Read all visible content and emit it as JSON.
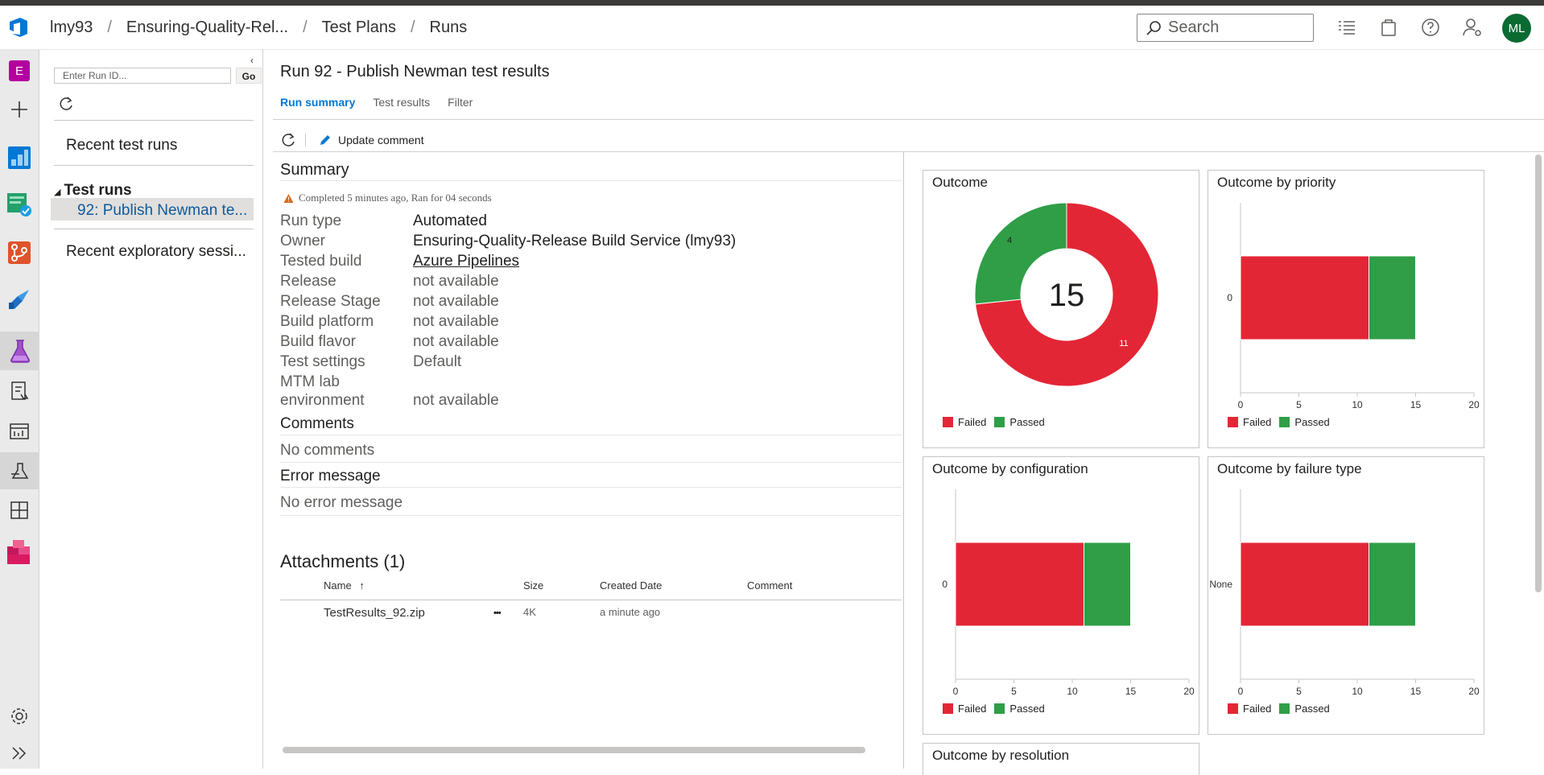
{
  "header": {
    "breadcrumbs": [
      "lmy93",
      "Ensuring-Quality-Rel...",
      "Test Plans",
      "Runs"
    ],
    "search_placeholder": "Search",
    "avatar_initials": "ML"
  },
  "leftnav": {
    "project_letter": "E",
    "icons": [
      "project-icon",
      "add-icon",
      "boards-icon",
      "test-plans-check-icon",
      "repos-icon",
      "pipelines-icon",
      "test-plans-icon",
      "test-plan-doc-icon",
      "dashboard-icon",
      "runs-icon",
      "grid-icon",
      "artifacts-icon",
      "settings-icon",
      "expand-icon"
    ]
  },
  "runpanel": {
    "run_id_placeholder": "Enter Run ID...",
    "go_label": "Go",
    "recent_runs": "Recent test runs",
    "test_runs_header": "Test runs",
    "selected_run": "92: Publish Newman te...",
    "recent_exploratory": "Recent exploratory sessi..."
  },
  "main": {
    "title": "Run 92 - Publish Newman test results",
    "tabs": [
      "Run summary",
      "Test results",
      "Filter"
    ],
    "toolbar": {
      "update_comment": "Update comment"
    }
  },
  "summary": {
    "heading": "Summary",
    "status": "Completed 5 minutes ago, Ran for 04 seconds",
    "fields": [
      {
        "label": "Run type",
        "value": "Automated"
      },
      {
        "label": "Owner",
        "value": "Ensuring-Quality-Release Build Service (lmy93)"
      },
      {
        "label": "Tested build",
        "value": "Azure Pipelines"
      },
      {
        "label": "Release",
        "value": "not available"
      },
      {
        "label": "Release Stage",
        "value": "not available"
      },
      {
        "label": "Build platform",
        "value": "not available"
      },
      {
        "label": "Build flavor",
        "value": "not available"
      },
      {
        "label": "Test settings",
        "value": "Default"
      },
      {
        "label": "MTM lab",
        "value": ""
      },
      {
        "label": "environment",
        "value": "not available"
      }
    ],
    "comments_heading": "Comments",
    "comments_value": "No comments",
    "error_heading": "Error message",
    "error_value": "No error message"
  },
  "attachments": {
    "heading": "Attachments (1)",
    "columns": [
      "Name",
      "Size",
      "Created Date",
      "Comment"
    ],
    "sort_arrow": "↑",
    "rows": [
      {
        "name": "TestResults_92.zip",
        "size": "4K",
        "created": "a minute ago",
        "comment": ""
      }
    ],
    "more_label": "•••"
  },
  "colors": {
    "failed": "#e32636",
    "passed": "#2f9e47",
    "accent": "#0078d4"
  },
  "chart_data": [
    {
      "type": "pie",
      "title": "Outcome",
      "center_label": "15",
      "labels": [
        "Failed",
        "Passed"
      ],
      "values": [
        11,
        4
      ],
      "legend": "bottom-left"
    },
    {
      "type": "bar",
      "title": "Outcome by priority",
      "orientation": "horizontal",
      "stacked": true,
      "categories": [
        "0"
      ],
      "series": [
        {
          "name": "Failed",
          "values": [
            11
          ]
        },
        {
          "name": "Passed",
          "values": [
            4
          ]
        }
      ],
      "xlim": [
        0,
        20
      ],
      "xticks": [
        "0",
        "5",
        "10",
        "15",
        "20"
      ],
      "legend": "bottom-left"
    },
    {
      "type": "bar",
      "title": "Outcome by configuration",
      "orientation": "horizontal",
      "stacked": true,
      "categories": [
        "0"
      ],
      "series": [
        {
          "name": "Failed",
          "values": [
            11
          ]
        },
        {
          "name": "Passed",
          "values": [
            4
          ]
        }
      ],
      "xlim": [
        0,
        20
      ],
      "xticks": [
        "0",
        "5",
        "10",
        "15",
        "20"
      ],
      "legend": "bottom-left"
    },
    {
      "type": "bar",
      "title": "Outcome by failure type",
      "orientation": "horizontal",
      "stacked": true,
      "categories": [
        "None"
      ],
      "series": [
        {
          "name": "Failed",
          "values": [
            11
          ]
        },
        {
          "name": "Passed",
          "values": [
            4
          ]
        }
      ],
      "xlim": [
        0,
        20
      ],
      "xticks": [
        "0",
        "5",
        "10",
        "15",
        "20"
      ],
      "legend": "bottom-left"
    },
    {
      "type": "bar",
      "title": "Outcome by resolution"
    }
  ]
}
